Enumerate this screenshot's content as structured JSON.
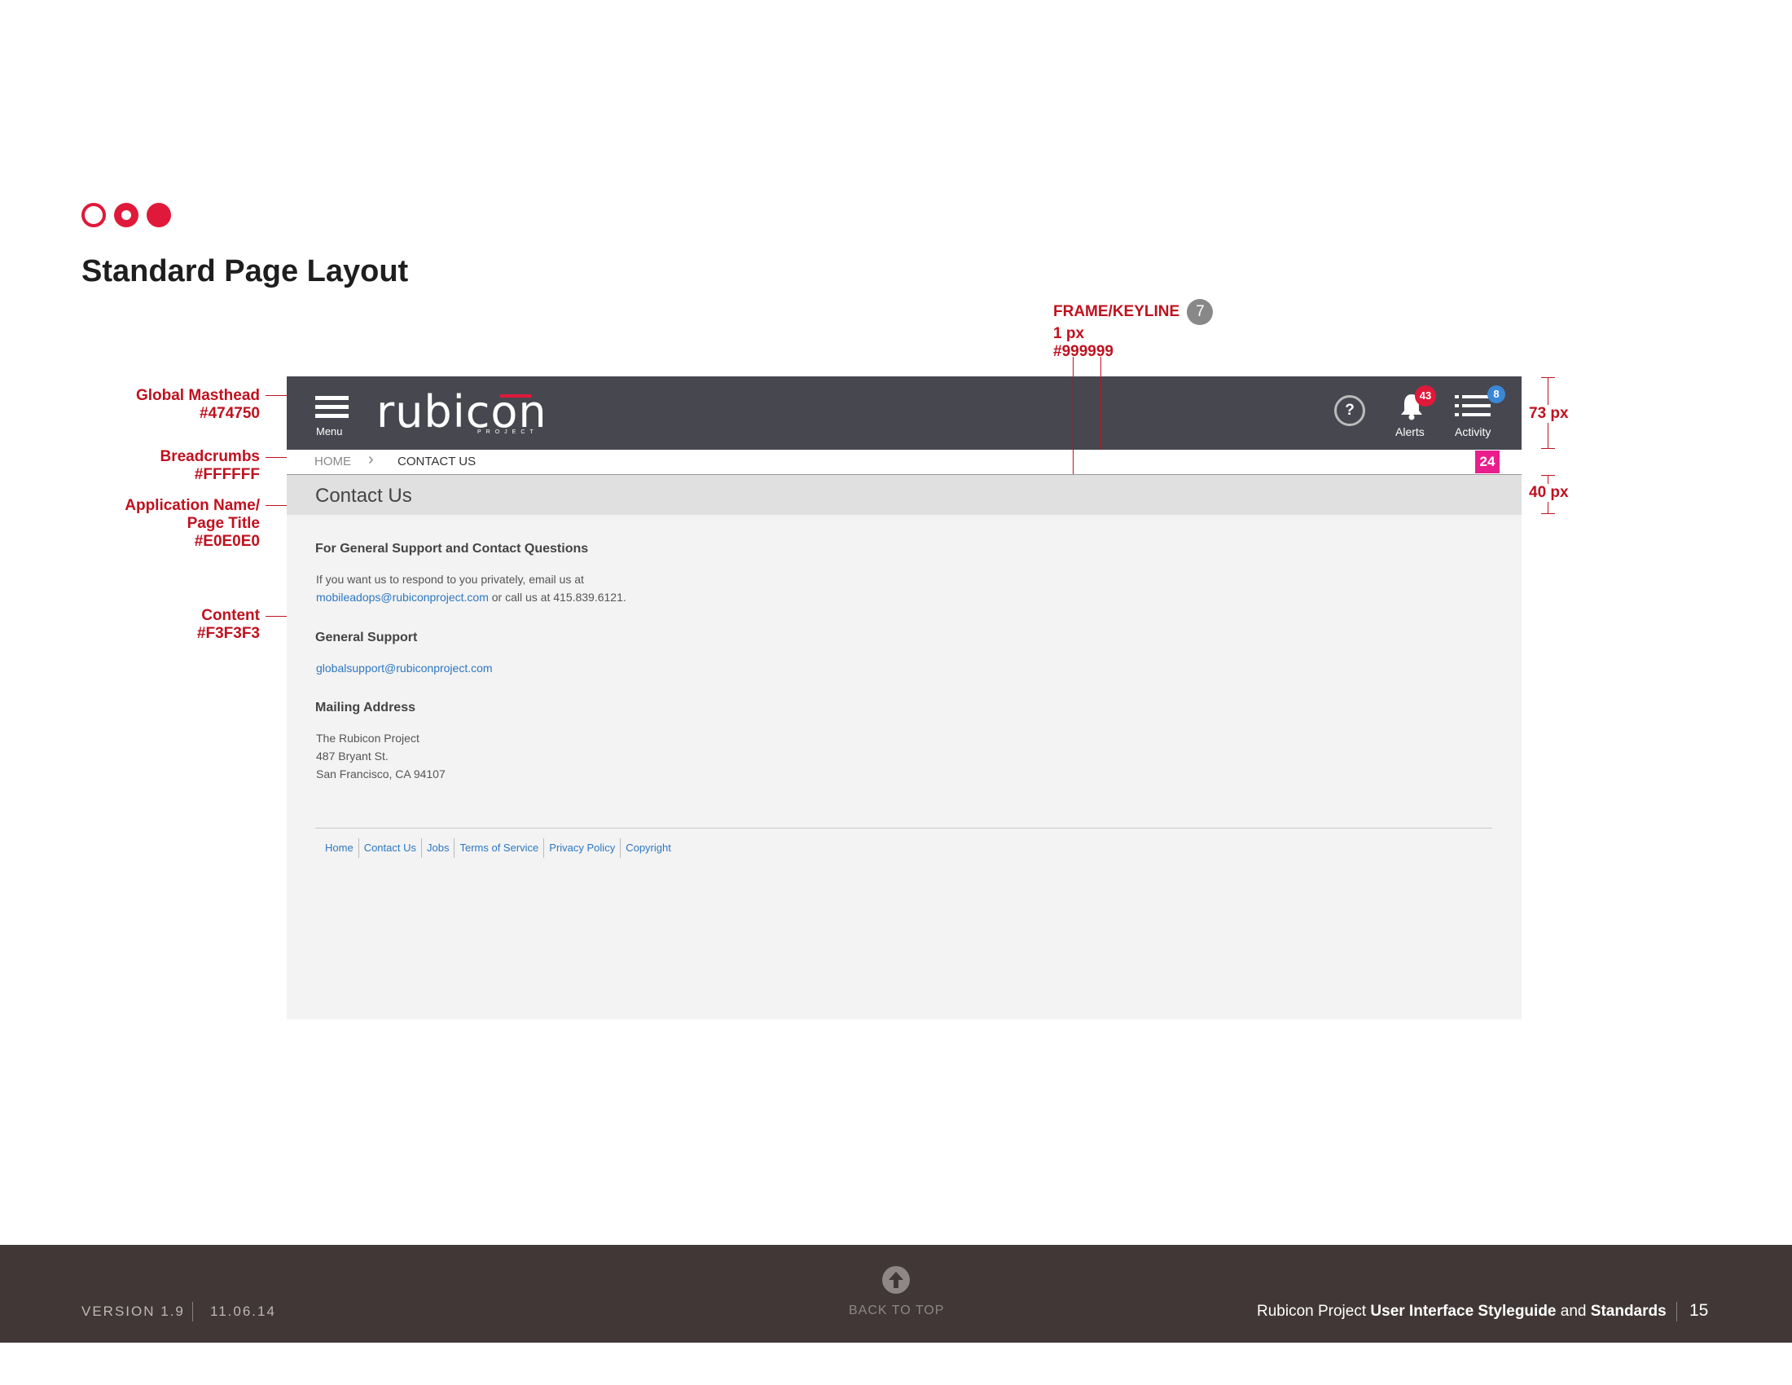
{
  "page": {
    "title": "Standard Page Layout"
  },
  "annotations": {
    "frame_title": "FRAME/KEYLINE",
    "frame_badge": "7",
    "frame_size": "1 px",
    "frame_color": "#999999",
    "masthead_name": "Global Masthead",
    "masthead_color": "#474750",
    "breadcrumbs_name": "Breadcrumbs",
    "breadcrumbs_color": "#FFFFFF",
    "apptitle_name_1": "Application Name/",
    "apptitle_name_2": "Page Title",
    "apptitle_color": "#E0E0E0",
    "content_name": "Content",
    "content_color": "#F3F3F3",
    "masthead_height": "73 px",
    "apptitle_height": "40 px"
  },
  "masthead": {
    "menu_label": "Menu",
    "logo_text": "rubicon",
    "logo_sub": "PROJECT",
    "help_symbol": "?",
    "alerts_count": "43",
    "alerts_label": "Alerts",
    "activity_count": "8",
    "activity_label": "Activity",
    "icons": [
      "menu-icon",
      "help-icon",
      "bell-icon",
      "list-icon"
    ]
  },
  "breadcrumbs": {
    "home": "HOME",
    "separator": "›",
    "current": "CONTACT US",
    "marker": "24"
  },
  "app": {
    "title": "Contact Us"
  },
  "content": {
    "section1_heading": "For General Support and Contact Questions",
    "section1_line1": "If you want us to respond to you privately, email us at",
    "section1_email": "mobileadops@rubiconproject.com",
    "section1_line2_rest": " or call us at 415.839.6121.",
    "section2_heading": "General Support",
    "section2_email": "globalsupport@rubiconproject.com",
    "section3_heading": "Mailing Address",
    "address_line1": "The Rubicon Project",
    "address_line2": "487 Bryant St.",
    "address_line3": "San Francisco, CA 94107"
  },
  "footer_links": [
    "Home",
    "Contact Us",
    "Jobs",
    "Terms of Service",
    "Privacy Policy",
    "Copyright"
  ],
  "page_footer": {
    "version": "VERSION 1.9",
    "date": "11.06.14",
    "back_to_top": "BACK TO TOP",
    "doc_title_plain_1": "Rubicon Project ",
    "doc_title_bold": "User Interface Styleguide",
    "doc_title_plain_2": " and ",
    "doc_title_bold_2": "Standards",
    "page_number": "15"
  },
  "colors": {
    "accent": "#e0193a",
    "masthead": "#474750",
    "breadcrumbs": "#FFFFFF",
    "apptitle": "#E0E0E0",
    "content": "#F3F3F3",
    "keyline": "#999999",
    "marker": "#e91e8c",
    "link": "#2d77c2",
    "footer_bg": "#403736"
  }
}
